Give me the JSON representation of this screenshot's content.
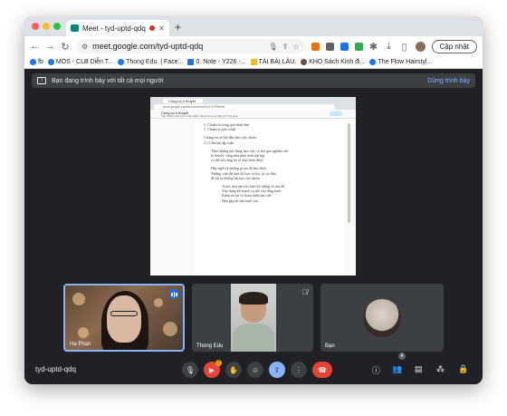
{
  "browser": {
    "tab_title": "Meet - tyd-uptd-qdq",
    "new_tab_symbol": "+",
    "url": "meet.google.com/tyd-uptd-qdq",
    "update_label": "Cập nhật",
    "bookmarks": [
      "fb",
      "MOS - CLB Diễn T...",
      "Thong Edu. | Face...",
      "0. Note - Y226 -...",
      "TÀI BÀI LẬU.",
      "KHO Sách Kinh đi...",
      "The Flow Hairstyl..."
    ]
  },
  "banner": {
    "text": "Bạn đang trình bày với tất cả mọi người",
    "stop_label": "Dừng trình bày"
  },
  "presented_doc": {
    "tab_title": "Công cụ lí thuyết",
    "url": "docs.google.com/document/d/1nTXOPf/edit",
    "doc_title": "Công cụ lí thuyết",
    "menus": "Tệp Chỉnh sửa Xem Chèn Định dạng Công cụ Tiện ích Trợ giúp",
    "lines": [
      "2. Chuẩn bị trong quá trình làm",
      "1. Chuẩn bị giáo trình",
      "",
      "Chúng em sẽ bắt đầu làm việc nhóm",
      "2.1 Chia bài lập luận",
      "",
      "Theo những nội dung làm việc có kết quả nghiên cứu",
      "lý thuyết, cũng như phát triển bài tập",
      "có thể nói rằng họ sẽ thực hiện được",
      "",
      "Hãy nghĩ về những gì em đã làm được",
      "Những cách để làm tốt hơn và học từ sai lầm",
      "để rút ra những bài học cho nhóm",
      "Trước tiên cần tìm hiểu kỹ lưỡng về chủ đề",
      "Xây dựng kế hoạch cụ thể cho từng bước",
      "Kiểm tra lại và hoàn thiện bài viết",
      "Hẹn gặp lại vào buổi sau"
    ]
  },
  "participants": [
    {
      "name": "Ha Phan",
      "speaking": true
    },
    {
      "name": "Thong Edu",
      "muted": true
    },
    {
      "name": "Bạn"
    }
  ],
  "controls": {
    "meeting_code": "tyd-uptd-qdq",
    "people_count": "4",
    "notice_badge": "!"
  }
}
